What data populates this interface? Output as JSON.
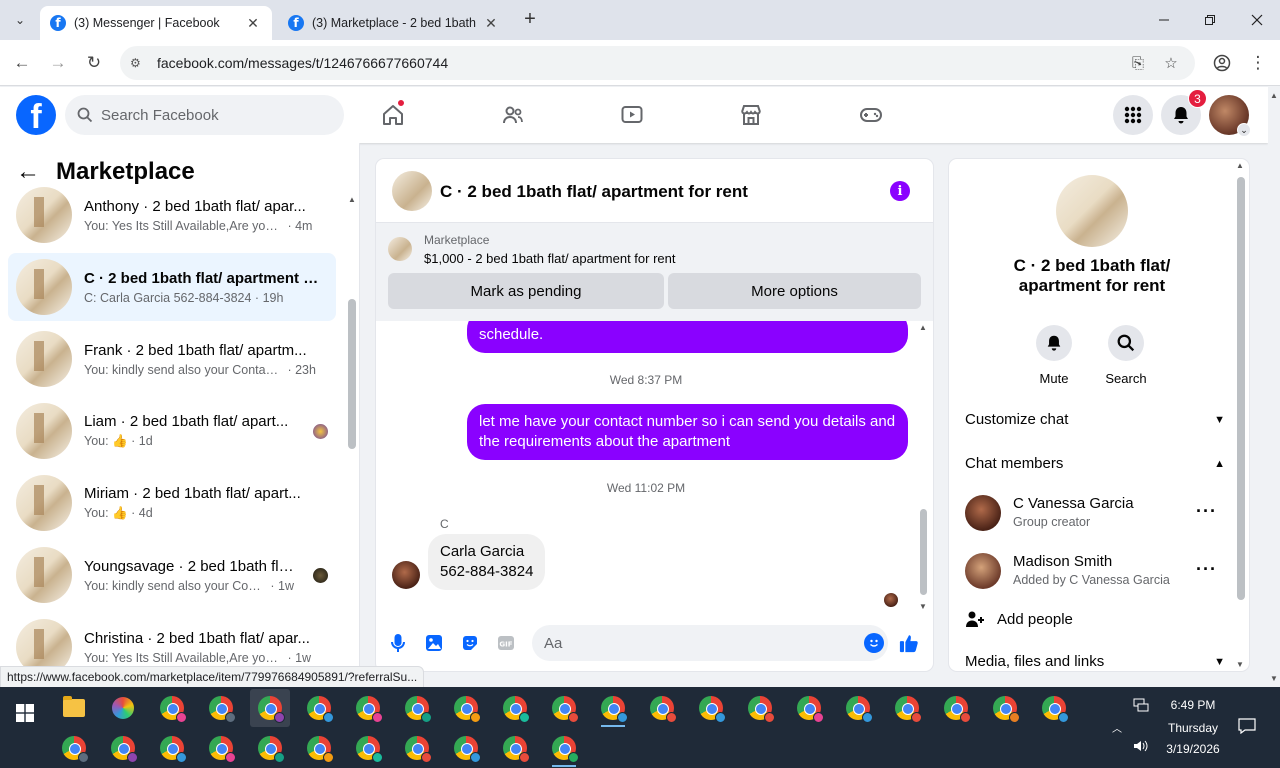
{
  "browser": {
    "tabs": [
      {
        "title": "(3) Messenger | Facebook",
        "active": true
      },
      {
        "title": "(3) Marketplace - 2 bed 1bath f",
        "active": false
      }
    ],
    "url": "facebook.com/messages/t/1246766677660744"
  },
  "fb_header": {
    "search_placeholder": "Search Facebook",
    "notification_count": "3"
  },
  "chat_list": {
    "title": "Marketplace",
    "conversations": [
      {
        "name": "Anthony · 2 bed 1bath flat/ apar...",
        "preview": "You: Yes Its Still Available,Are you i...",
        "time": "4m",
        "active": false
      },
      {
        "name": "C · 2 bed 1bath flat/ apartment f...",
        "preview": "C: Carla Garcia 562-884-3824",
        "time": "19h",
        "active": true
      },
      {
        "name": "Frank · 2 bed 1bath flat/ apartm...",
        "preview": "You: kindly send also your Contact...",
        "time": "23h",
        "active": false
      },
      {
        "name": "Liam · 2 bed 1bath flat/ apart...",
        "preview": "You:",
        "time": "1d",
        "active": false,
        "thumb": "like"
      },
      {
        "name": "Miriam · 2 bed 1bath flat/ apart...",
        "preview": "You:",
        "time": "4d",
        "active": false,
        "thumb": "like"
      },
      {
        "name": "Youngsavage · 2 bed 1bath fla...",
        "preview": "You: kindly send also your Conta...",
        "time": "1w",
        "active": false
      },
      {
        "name": "Christina · 2 bed 1bath flat/ apar...",
        "preview": "You: Yes Its Still Available,Are you i...",
        "time": "1w",
        "active": false
      }
    ]
  },
  "conversation": {
    "title": "C · 2 bed 1bath flat/ apartment for rent",
    "marketplace_label": "Marketplace",
    "listing": "$1,000 - 2 bed 1bath flat/ apartment for rent",
    "mark_pending_label": "Mark as pending",
    "more_options_label": "More options",
    "messages": {
      "msg1": "schedule.",
      "ts1": "Wed 8:37 PM",
      "msg2_line1": "let me have your contact number so i can send you details and",
      "msg2_line2": "the requirements about the apartment",
      "ts2": "Wed 11:02 PM",
      "sender": "C",
      "msg3_line1": "Carla Garcia",
      "msg3_line2": "562-884-3824"
    },
    "composer_placeholder": "Aa"
  },
  "info_panel": {
    "title_line1": "C · 2 bed 1bath flat/",
    "title_line2": "apartment for rent",
    "mute_label": "Mute",
    "search_label": "Search",
    "customize_chat": "Customize chat",
    "chat_members": "Chat members",
    "members": [
      {
        "name": "C Vanessa Garcia",
        "role": "Group creator"
      },
      {
        "name": "Madison Smith",
        "role": "Added by C Vanessa Garcia"
      }
    ],
    "add_people": "Add people",
    "media_files": "Media, files and links"
  },
  "status_url": "https://www.facebook.com/marketplace/item/779976684905891/?referralSu...",
  "taskbar": {
    "time": "6:49 PM",
    "day": "Thursday",
    "date": "3/19/2026"
  },
  "colors": {
    "messenger_purple": "#8a01ff",
    "fb_blue": "#0866ff",
    "notification_red": "#e41e3f",
    "active_chat_bg": "#ebf5ff"
  }
}
